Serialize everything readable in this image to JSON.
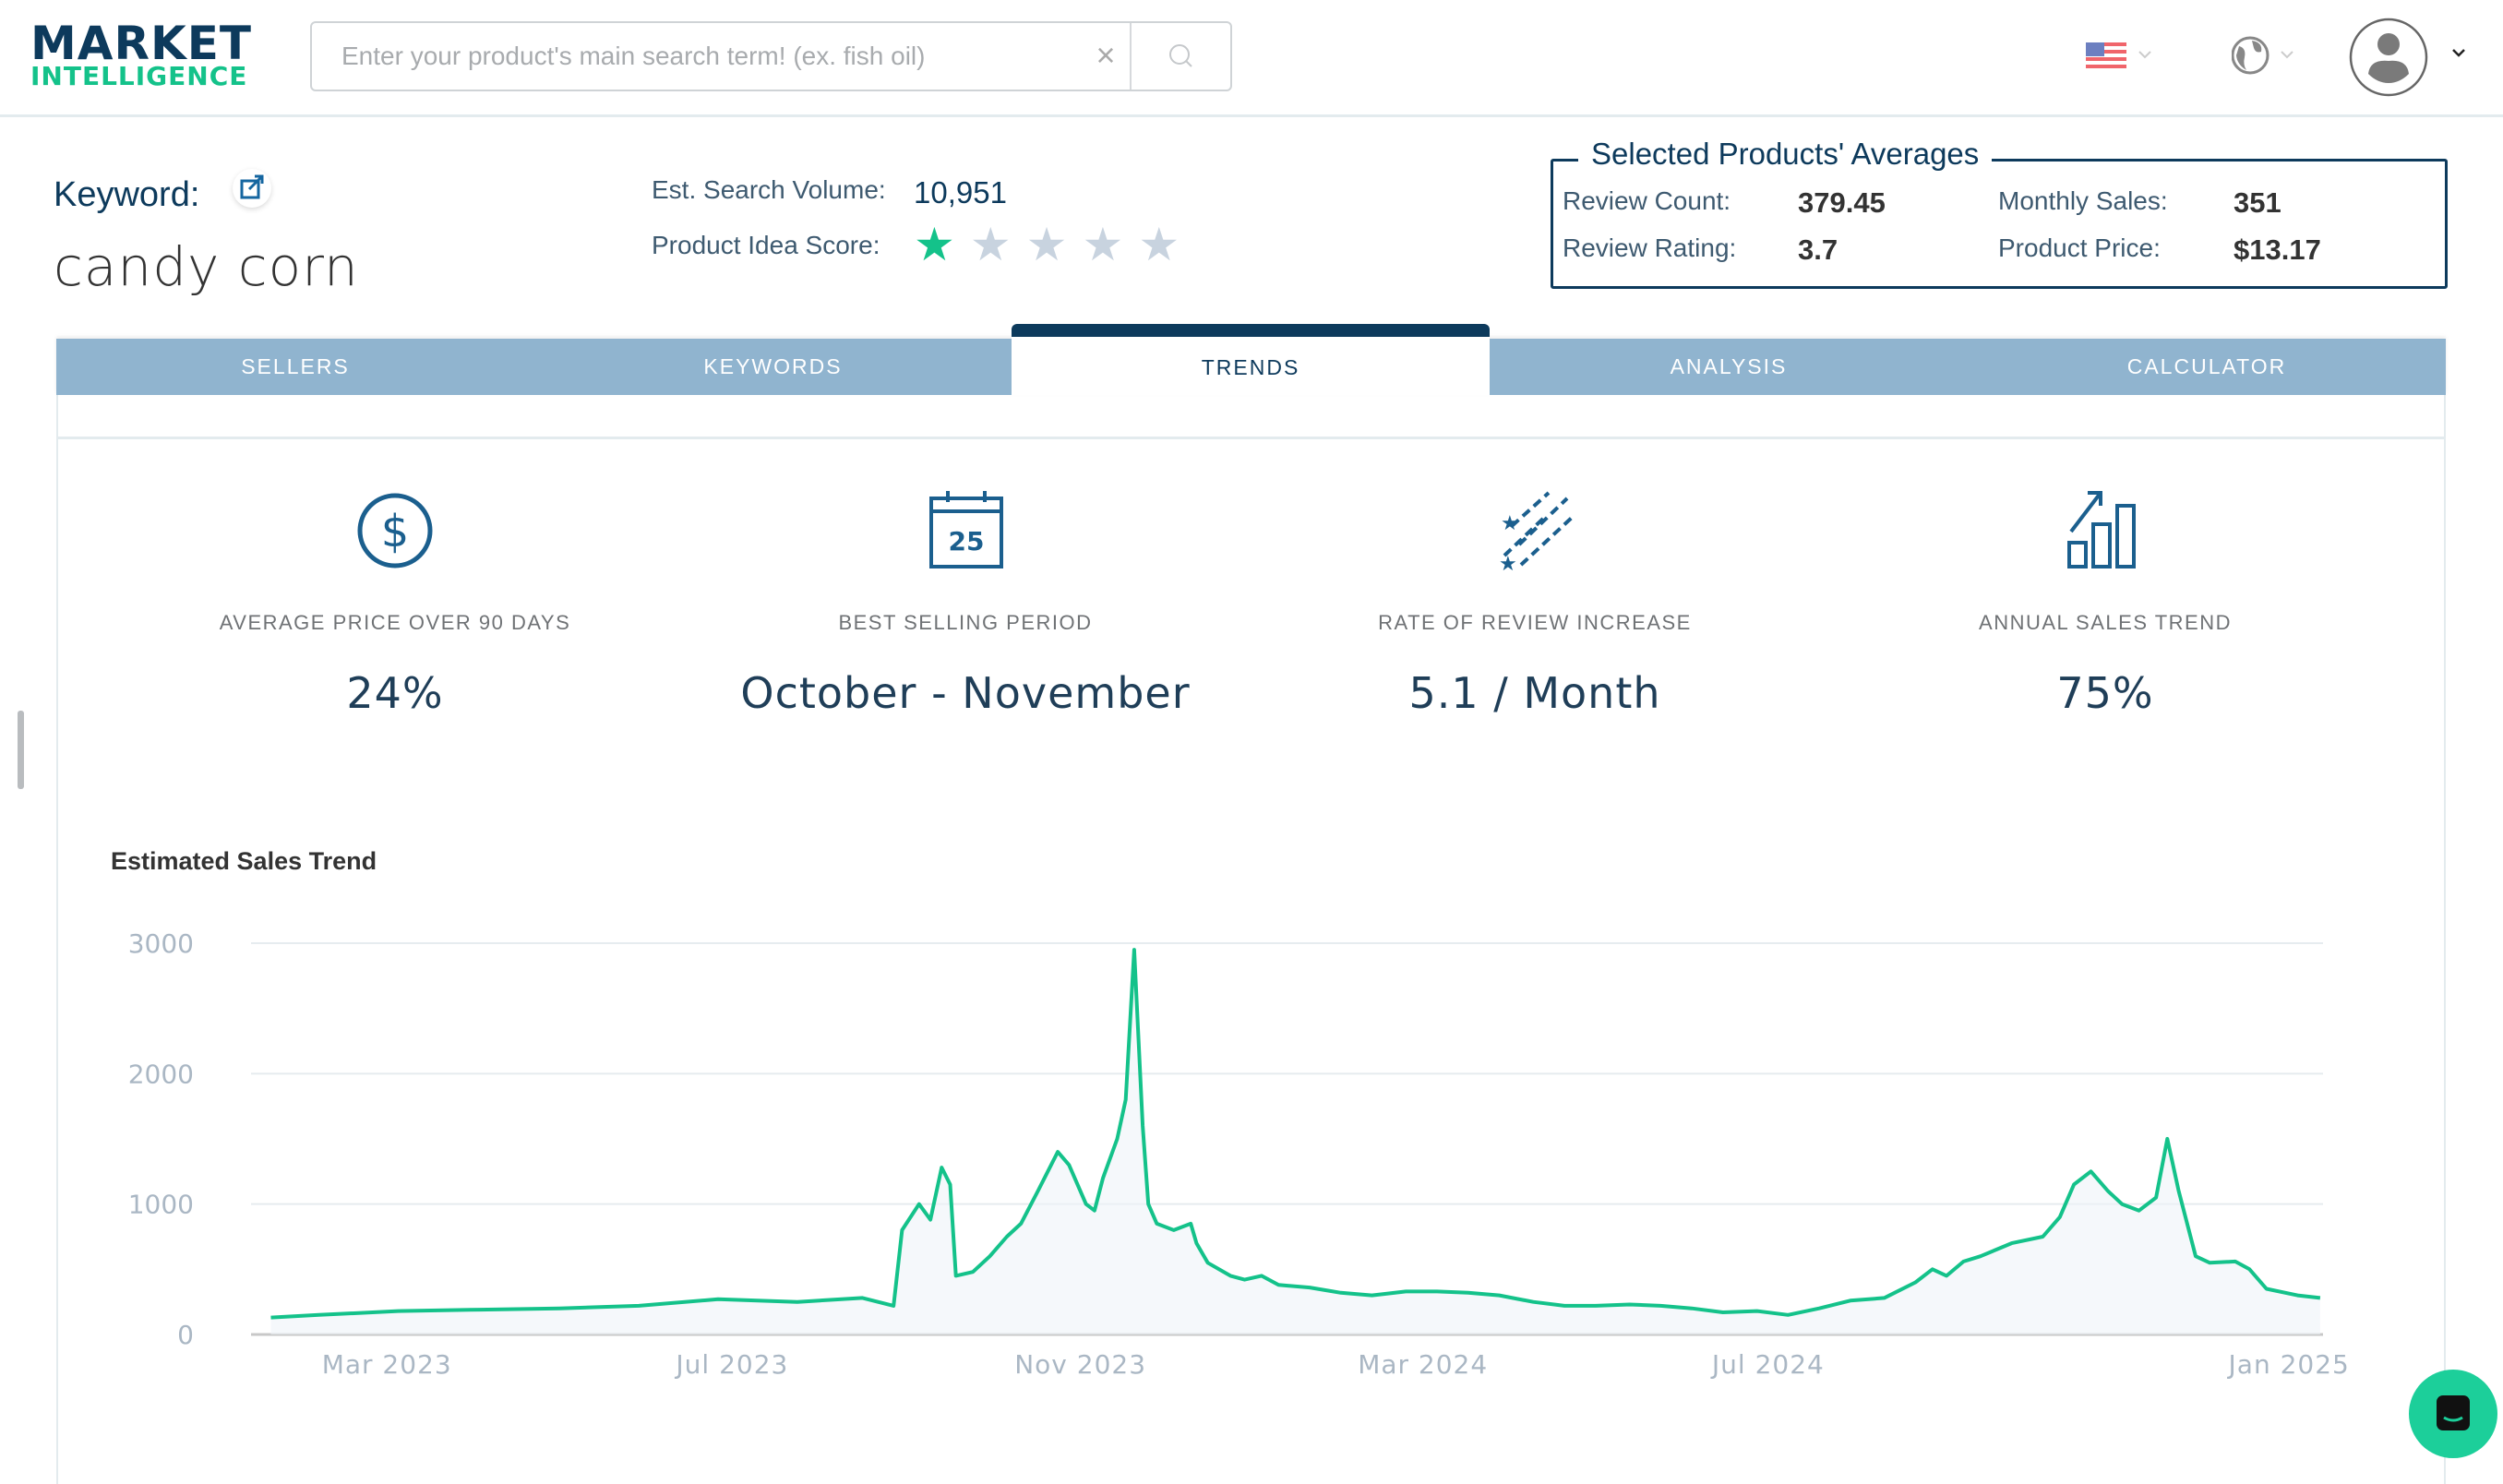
{
  "header": {
    "logo_line1": "MARKET",
    "logo_line2": "INTELLIGENCE",
    "search_placeholder": "Enter your product's main search term! (ex. fish oil)",
    "search_value": "",
    "clear_icon": "close-icon",
    "search_icon": "search-icon",
    "country_icon": "us-flag-icon",
    "language_icon": "globe-icon",
    "account_icon": "user-avatar-icon"
  },
  "keyword": {
    "label": "Keyword:",
    "value": "candy corn"
  },
  "stats": {
    "search_volume_label": "Est. Search Volume:",
    "search_volume": "10,951",
    "score_label": "Product Idea Score:",
    "score": 1,
    "score_max": 5
  },
  "averages": {
    "title": "Selected Products' Averages",
    "review_count_label": "Review Count:",
    "review_count": "379.45",
    "review_rating_label": "Review Rating:",
    "review_rating": "3.7",
    "monthly_sales_label": "Monthly Sales:",
    "monthly_sales": "351",
    "product_price_label": "Product Price:",
    "product_price": "$13.17"
  },
  "tabs": [
    {
      "label": "SELLERS",
      "active": false
    },
    {
      "label": "KEYWORDS",
      "active": false
    },
    {
      "label": "TRENDS",
      "active": true
    },
    {
      "label": "ANALYSIS",
      "active": false
    },
    {
      "label": "CALCULATOR",
      "active": false
    }
  ],
  "cards": [
    {
      "icon": "dollar-circle-icon",
      "label": "AVERAGE PRICE OVER 90 DAYS",
      "value": "24%"
    },
    {
      "icon": "calendar-icon",
      "label": "BEST SELLING PERIOD",
      "value": "October - November",
      "icon_text": "25"
    },
    {
      "icon": "shooting-stars-icon",
      "label": "RATE OF REVIEW INCREASE",
      "value": "5.1 / Month"
    },
    {
      "icon": "bar-chart-up-icon",
      "label": "ANNUAL SALES TREND",
      "value": "75%"
    }
  ],
  "colors": {
    "brand_dark": "#0d3a5c",
    "brand_green": "#14c28a",
    "tab_bg": "#90b4cf",
    "line": "#14c28a",
    "star_on": "#14c28a",
    "star_off": "#c8d3df"
  },
  "chart_data": {
    "type": "area",
    "title": "Estimated Sales Trend",
    "xlabel": "",
    "ylabel": "",
    "ylim": [
      0,
      3000
    ],
    "xlim": [
      "2023-01-12",
      "2025-01-13"
    ],
    "yticks": [
      "0",
      "1000",
      "2000",
      "3000"
    ],
    "xticks": [
      {
        "date": "2023-03-01",
        "label": "Mar 2023"
      },
      {
        "date": "2023-07-01",
        "label": "Jul 2023"
      },
      {
        "date": "2023-11-01",
        "label": "Nov 2023"
      },
      {
        "date": "2024-03-01",
        "label": "Mar 2024"
      },
      {
        "date": "2024-07-01",
        "label": "Jul 2024"
      },
      {
        "date": "2025-01-01",
        "label": "Jan 2025"
      }
    ],
    "grid": true,
    "x": [
      "2023-01-19",
      "2023-02-05",
      "2023-03-05",
      "2023-04-03",
      "2023-05-01",
      "2023-05-29",
      "2023-06-26",
      "2023-07-24",
      "2023-08-16",
      "2023-08-27",
      "2023-08-30",
      "2023-09-05",
      "2023-09-09",
      "2023-09-13",
      "2023-09-16",
      "2023-09-18",
      "2023-09-24",
      "2023-09-30",
      "2023-10-06",
      "2023-10-11",
      "2023-10-17",
      "2023-10-24",
      "2023-10-28",
      "2023-11-03",
      "2023-11-06",
      "2023-11-09",
      "2023-11-14",
      "2023-11-17",
      "2023-11-20",
      "2023-11-23",
      "2023-11-25",
      "2023-11-28",
      "2023-12-04",
      "2023-12-10",
      "2023-12-12",
      "2023-12-16",
      "2023-12-24",
      "2023-12-29",
      "2024-01-04",
      "2024-01-10",
      "2024-01-21",
      "2024-02-01",
      "2024-02-12",
      "2024-02-24",
      "2024-03-06",
      "2024-03-17",
      "2024-03-28",
      "2024-04-09",
      "2024-04-20",
      "2024-05-01",
      "2024-05-13",
      "2024-05-24",
      "2024-06-04",
      "2024-06-15",
      "2024-06-27",
      "2024-07-08",
      "2024-07-19",
      "2024-07-30",
      "2024-08-11",
      "2024-08-22",
      "2024-08-28",
      "2024-09-02",
      "2024-09-08",
      "2024-09-14",
      "2024-09-25",
      "2024-10-06",
      "2024-10-12",
      "2024-10-17",
      "2024-10-23",
      "2024-10-29",
      "2024-11-03",
      "2024-11-09",
      "2024-11-15",
      "2024-11-19",
      "2024-11-23",
      "2024-11-29",
      "2024-12-04",
      "2024-12-13",
      "2024-12-18",
      "2024-12-24",
      "2025-01-04",
      "2025-01-12"
    ],
    "values": [
      130,
      150,
      180,
      190,
      200,
      220,
      270,
      250,
      280,
      220,
      800,
      1000,
      880,
      1280,
      1150,
      450,
      480,
      600,
      750,
      850,
      1100,
      1400,
      1300,
      1000,
      950,
      1200,
      1500,
      1800,
      2950,
      1600,
      1000,
      850,
      800,
      850,
      700,
      550,
      450,
      420,
      450,
      380,
      360,
      320,
      300,
      330,
      330,
      320,
      300,
      250,
      220,
      220,
      230,
      220,
      200,
      170,
      180,
      150,
      200,
      260,
      280,
      400,
      500,
      450,
      560,
      600,
      700,
      750,
      900,
      1150,
      1250,
      1100,
      1000,
      950,
      1050,
      1500,
      1100,
      600,
      550,
      560,
      500,
      350,
      300,
      280
    ]
  }
}
